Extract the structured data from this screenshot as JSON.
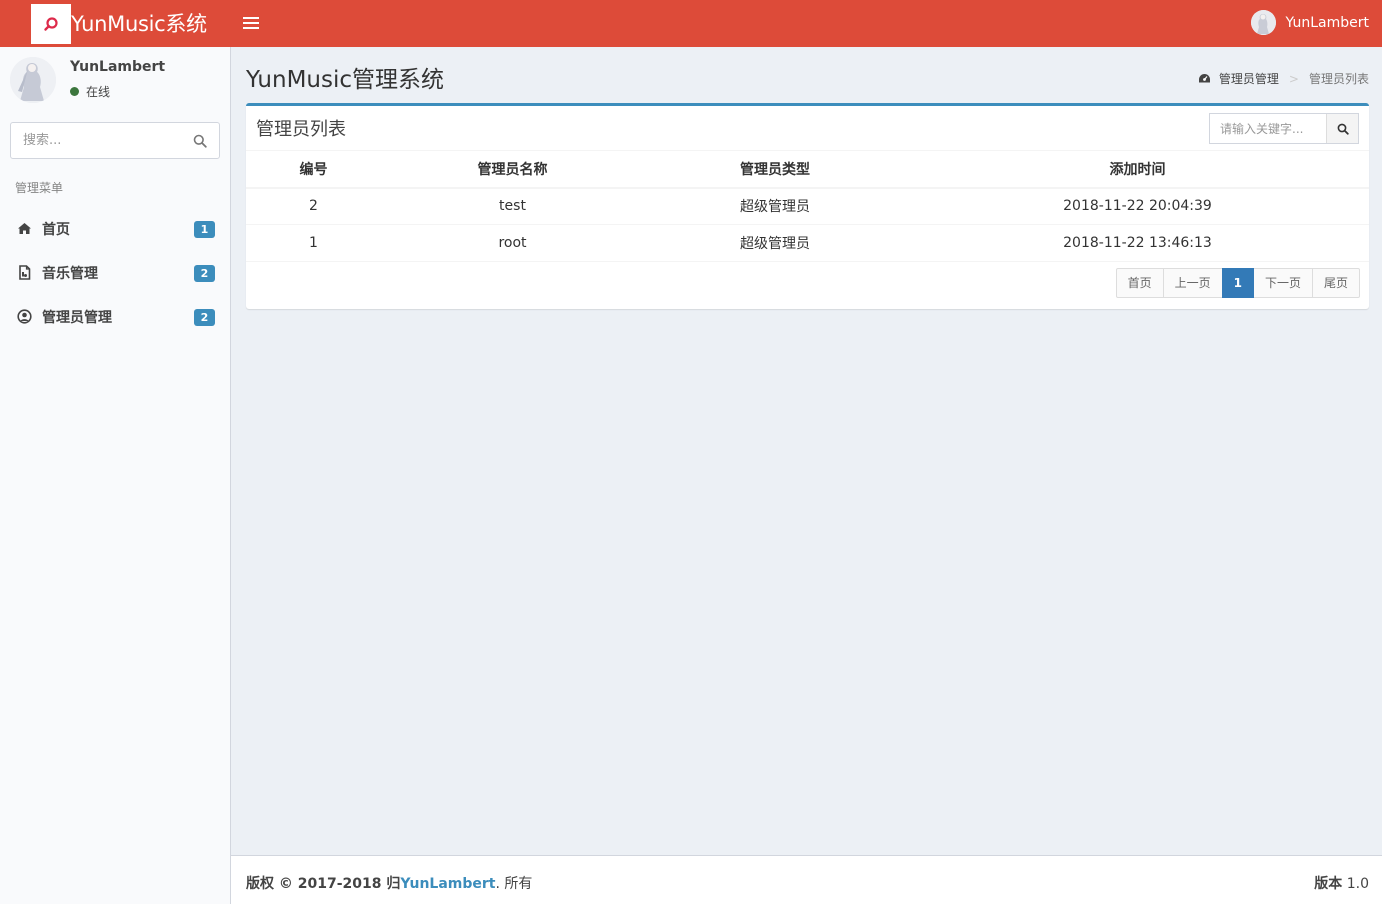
{
  "header": {
    "brand": "YunMusic系统",
    "user_name": "YunLambert",
    "accent_color": "#dd4b39"
  },
  "sidebar": {
    "user": {
      "name": "YunLambert",
      "status": "在线"
    },
    "search": {
      "placeholder": "搜索..."
    },
    "menu_header": "管理菜单",
    "items": [
      {
        "label": "首页",
        "badge": "1",
        "icon": "home-icon"
      },
      {
        "label": "音乐管理",
        "badge": "2",
        "icon": "music-file-icon"
      },
      {
        "label": "管理员管理",
        "badge": "2",
        "icon": "user-circle-icon"
      }
    ]
  },
  "content": {
    "title": "YunMusic管理系统",
    "breadcrumb": {
      "parent": "管理员管理",
      "current": "管理员列表"
    }
  },
  "box": {
    "title": "管理员列表",
    "search_placeholder": "请输入关键字...",
    "columns": [
      "编号",
      "管理员名称",
      "管理员类型",
      "添加时间"
    ],
    "rows": [
      [
        "2",
        "test",
        "超级管理员",
        "2018-11-22 20:04:39"
      ],
      [
        "1",
        "root",
        "超级管理员",
        "2018-11-22 13:46:13"
      ]
    ],
    "pagination": {
      "first": "首页",
      "prev": "上一页",
      "current": "1",
      "next": "下一页",
      "last": "尾页"
    }
  },
  "footer": {
    "copyright_prefix": "版权 © 2017-2018 归",
    "owner": "YunLambert",
    "copyright_suffix": ". 所有",
    "version_label": "版本",
    "version": "1.0"
  }
}
